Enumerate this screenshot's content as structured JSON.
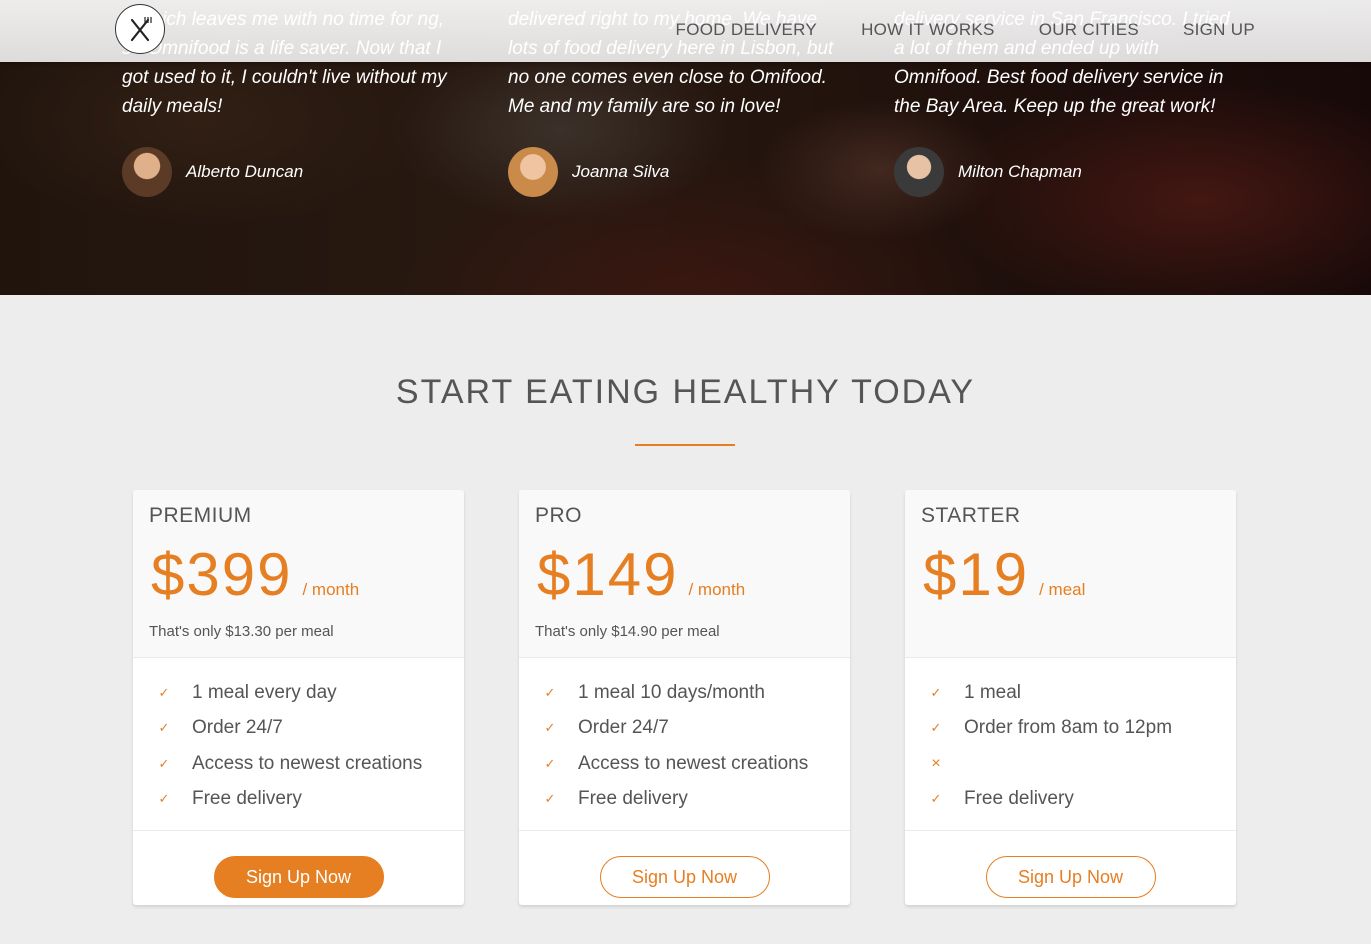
{
  "nav": {
    "links": [
      "FOOD DELIVERY",
      "HOW IT WORKS",
      "OUR CITIES",
      "SIGN UP"
    ]
  },
  "testimonials": [
    {
      "quote": "p which leaves me with no time for ng, so Omnifood is a life saver. Now that I got used to it, I couldn't live without my daily meals!",
      "author": "Alberto Duncan"
    },
    {
      "quote": "delivered right to my home. We have lots of food delivery here in Lisbon, but no one comes even close to Omifood. Me and my family are so in love!",
      "author": "Joanna Silva"
    },
    {
      "quote": "delivery service in San Francisco. I tried a lot of them and ended up with Omnifood. Best food delivery service in the Bay Area. Keep up the great work!",
      "author": "Milton Chapman"
    }
  ],
  "section": {
    "title": "START EATING HEALTHY TODAY"
  },
  "plans": [
    {
      "name": "PREMIUM",
      "price": "$399",
      "per": "/ month",
      "note": "That's only $13.30 per meal",
      "features": [
        "1 meal every day",
        "Order 24/7",
        "Access to newest creations",
        "Free delivery"
      ],
      "button": "Sign Up Now"
    },
    {
      "name": "PRO",
      "price": "$149",
      "per": "/ month",
      "note": "That's only $14.90 per meal",
      "features": [
        "1 meal 10 days/month",
        "Order 24/7",
        "Access to newest creations",
        "Free delivery"
      ],
      "button": "Sign Up Now"
    },
    {
      "name": "STARTER",
      "price": "$19",
      "per": "/ meal",
      "note": "",
      "features": [
        "1 meal",
        "Order from 8am to 12pm",
        "",
        "Free delivery"
      ],
      "button": "Sign Up Now"
    }
  ],
  "colors": {
    "accent": "#e67e22",
    "text": "#555555",
    "background": "#ededed"
  }
}
